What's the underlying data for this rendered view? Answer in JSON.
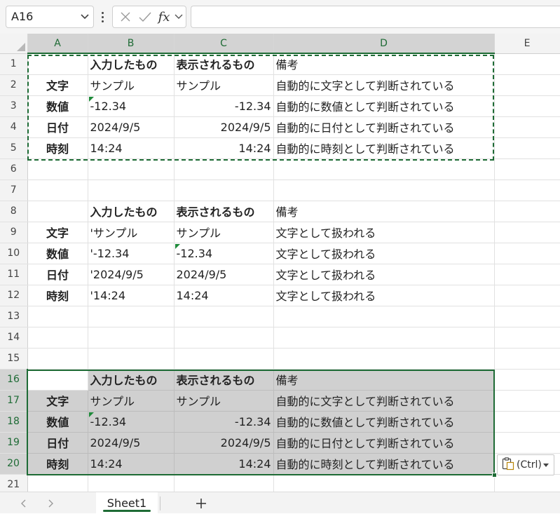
{
  "formula_bar": {
    "name_box": "A16",
    "fx_label": "fx",
    "formula": ""
  },
  "columns": [
    "A",
    "B",
    "C",
    "D",
    "E"
  ],
  "rows": [
    {
      "n": "1",
      "a": "",
      "b": "入力したもの",
      "c": "表示されるもの",
      "d": "備考"
    },
    {
      "n": "2",
      "a": "文字",
      "b": "サンプル",
      "c": "サンプル",
      "d": "自動的に文字として判断されている"
    },
    {
      "n": "3",
      "a": "数値",
      "b": "-12.34",
      "c": "-12.34",
      "d": "自動的に数値として判断されている"
    },
    {
      "n": "4",
      "a": "日付",
      "b": "2024/9/5",
      "c": "2024/9/5",
      "d": "自動的に日付として判断されている"
    },
    {
      "n": "5",
      "a": "時刻",
      "b": "14:24",
      "c": "14:24",
      "d": "自動的に時刻として判断されている"
    },
    {
      "n": "6",
      "a": "",
      "b": "",
      "c": "",
      "d": ""
    },
    {
      "n": "7",
      "a": "",
      "b": "",
      "c": "",
      "d": ""
    },
    {
      "n": "8",
      "a": "",
      "b": "入力したもの",
      "c": "表示されるもの",
      "d": "備考"
    },
    {
      "n": "9",
      "a": "文字",
      "b": "'サンプル",
      "c": "サンプル",
      "d": "文字として扱われる"
    },
    {
      "n": "10",
      "a": "数値",
      "b": "'-12.34",
      "c": "-12.34",
      "d": "文字として扱われる"
    },
    {
      "n": "11",
      "a": "日付",
      "b": "'2024/9/5",
      "c": "2024/9/5",
      "d": "文字として扱われる"
    },
    {
      "n": "12",
      "a": "時刻",
      "b": "'14:24",
      "c": "14:24",
      "d": "文字として扱われる"
    },
    {
      "n": "13",
      "a": "",
      "b": "",
      "c": "",
      "d": ""
    },
    {
      "n": "14",
      "a": "",
      "b": "",
      "c": "",
      "d": ""
    },
    {
      "n": "15",
      "a": "",
      "b": "",
      "c": "",
      "d": ""
    },
    {
      "n": "16",
      "a": "",
      "b": "入力したもの",
      "c": "表示されるもの",
      "d": "備考"
    },
    {
      "n": "17",
      "a": "文字",
      "b": "サンプル",
      "c": "サンプル",
      "d": "自動的に文字として判断されている"
    },
    {
      "n": "18",
      "a": "数値",
      "b": "-12.34",
      "c": "-12.34",
      "d": "自動的に数値として判断されている"
    },
    {
      "n": "19",
      "a": "日付",
      "b": "2024/9/5",
      "c": "2024/9/5",
      "d": "自動的に日付として判断されている"
    },
    {
      "n": "20",
      "a": "時刻",
      "b": "14:24",
      "c": "14:24",
      "d": "自動的に時刻として判断されている"
    },
    {
      "n": "21",
      "a": "",
      "b": "",
      "c": "",
      "d": ""
    }
  ],
  "paste_options": {
    "label": "(Ctrl)",
    "icon": "clipboard-icon"
  },
  "sheet_tabs": {
    "active": "Sheet1",
    "add_icon": "plus-icon"
  },
  "colors": {
    "accent": "#1e6b35",
    "selection_fill": "#d0d0d0"
  }
}
